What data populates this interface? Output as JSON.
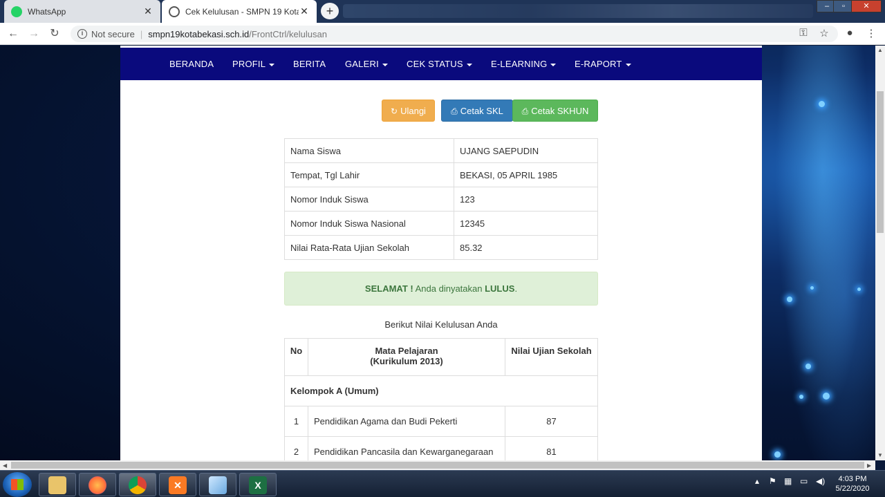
{
  "browser": {
    "tabs": [
      {
        "title": "WhatsApp",
        "close": "✕"
      },
      {
        "title": "Cek Kelulusan - SMPN 19 Kota Be",
        "close": "✕"
      }
    ],
    "new_tab": "+",
    "security": "Not secure",
    "url_host": "smpn19kotabekasi.sch.id",
    "url_path": "/FrontCtrl/kelulusan"
  },
  "nav": {
    "items": [
      {
        "label": "BERANDA",
        "dropdown": false
      },
      {
        "label": "PROFIL",
        "dropdown": true
      },
      {
        "label": "BERITA",
        "dropdown": false
      },
      {
        "label": "GALERI",
        "dropdown": true
      },
      {
        "label": "CEK STATUS",
        "dropdown": true
      },
      {
        "label": "E-LEARNING",
        "dropdown": true
      },
      {
        "label": "E-RAPORT",
        "dropdown": true
      }
    ]
  },
  "actions": {
    "reset": "Ulangi",
    "print_skl": "Cetak SKL",
    "print_skhun": "Cetak SKHUN"
  },
  "student": {
    "rows": [
      {
        "label": "Nama Siswa",
        "value": "UJANG SAEPUDIN"
      },
      {
        "label": "Tempat, Tgl Lahir",
        "value": "BEKASI, 05 APRIL 1985"
      },
      {
        "label": "Nomor Induk Siswa",
        "value": "123"
      },
      {
        "label": "Nomor Induk Siswa Nasional",
        "value": "12345"
      },
      {
        "label": "Nilai Rata-Rata Ujian Sekolah",
        "value": "85.32"
      }
    ]
  },
  "result": {
    "prefix": "SELAMAT !",
    "middle": " Anda dinyatakan ",
    "status": "LULUS",
    "suffix": "."
  },
  "grades": {
    "caption": "Berikut Nilai Kelulusan Anda",
    "headers": {
      "no": "No",
      "subject_line1": "Mata Pelajaran",
      "subject_line2": "(Kurikulum 2013)",
      "score": "Nilai Ujian Sekolah"
    },
    "group_a": "Kelompok A (Umum)",
    "rows": [
      {
        "no": "1",
        "subject": "Pendidikan Agama dan Budi Pekerti",
        "score": "87"
      },
      {
        "no": "2",
        "subject": "Pendidikan Pancasila dan Kewarganegaraan",
        "score": "81"
      }
    ]
  },
  "taskbar": {
    "time": "4:03 PM",
    "date": "5/22/2020"
  },
  "colors": {
    "navbar": "#0a0a7d",
    "warning": "#f0ad4e",
    "primary": "#337ab7",
    "success": "#5cb85c",
    "alert_bg": "#dff0d8"
  }
}
